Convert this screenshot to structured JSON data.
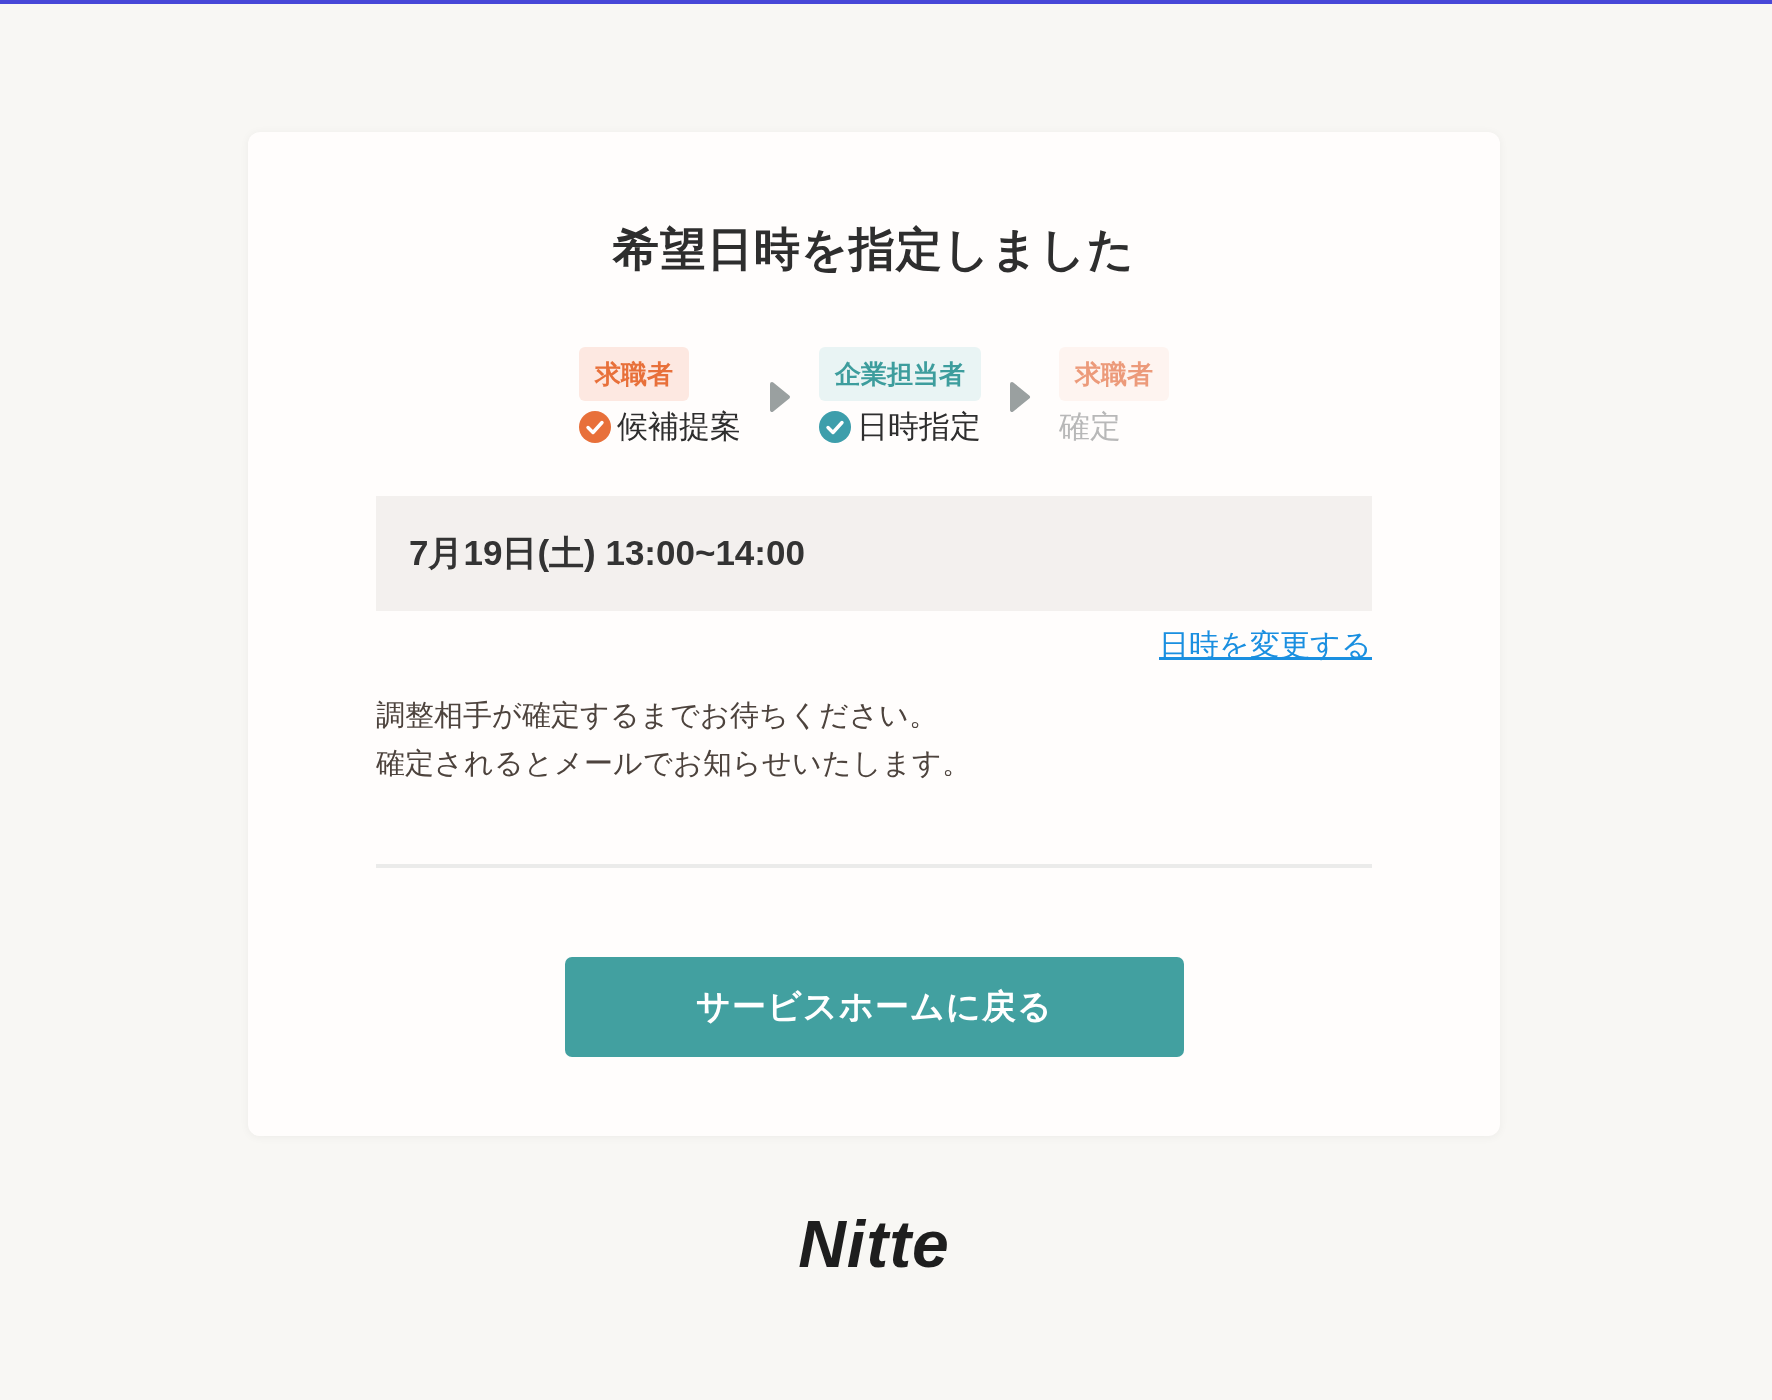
{
  "title": "希望日時を指定しました",
  "steps": [
    {
      "actor": "求職者",
      "label": "候補提案",
      "kind": "seeker",
      "done": true
    },
    {
      "actor": "企業担当者",
      "label": "日時指定",
      "kind": "company",
      "done": true
    },
    {
      "actor": "求職者",
      "label": "確定",
      "kind": "seeker",
      "done": false
    }
  ],
  "datetime": "7月19日(土) 13:00~14:00",
  "change_link": "日時を変更する",
  "message": [
    "調整相手が確定するまでお待ちください。",
    "確定されるとメールでお知らせいたします。"
  ],
  "home_button": "サービスホームに戻る",
  "logo": "Nitte"
}
